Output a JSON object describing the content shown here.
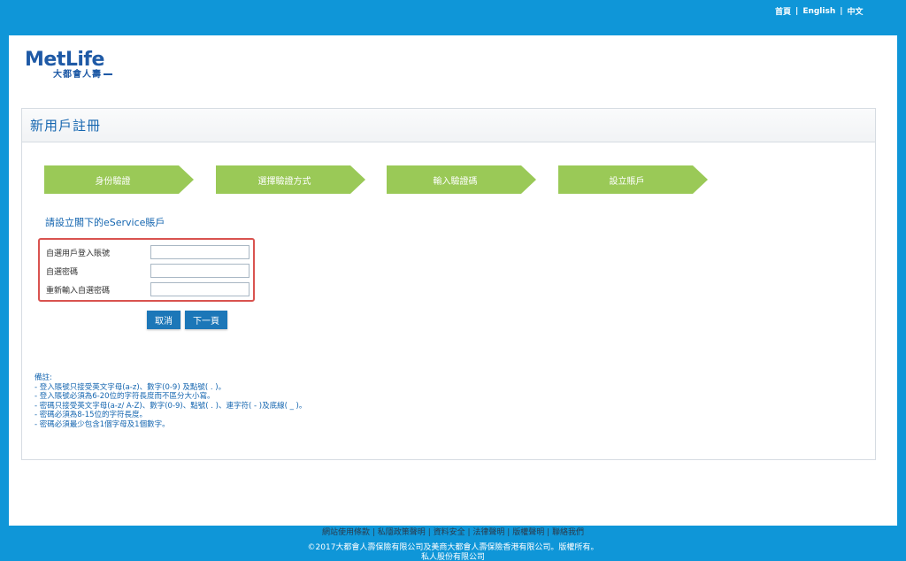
{
  "top_links": [
    "首頁",
    "English",
    "中文"
  ],
  "logo": {
    "main": "MetLife",
    "sub": "大都會人壽"
  },
  "page_title": "新用戶註冊",
  "steps": [
    "身份驗證",
    "選擇驗證方式",
    "輸入驗證碼",
    "設立賬戶"
  ],
  "section_title": "請設立閣下的eService賬戶",
  "form": {
    "fields": [
      {
        "label": "自選用戶登入賬號",
        "value": ""
      },
      {
        "label": "自選密碼",
        "value": ""
      },
      {
        "label": "重新輸入自選密碼",
        "value": ""
      }
    ]
  },
  "buttons": {
    "cancel": "取消",
    "next": "下一頁"
  },
  "notes": {
    "title": "備註:",
    "items": [
      "- 登入賬號只接受英文字母(a-z)、數字(0-9) 及點號( . )。",
      "- 登入賬號必須為6-20位的字符長度而不區分大小寫。",
      "- 密碼只接受英文字母(a-z/ A-Z)、數字(0-9)、點號( . )、連字符( - )及底線( _ )。",
      "- 密碼必須為8-15位的字符長度。",
      "- 密碼必須最少包含1個字母及1個數字。"
    ]
  },
  "footer": {
    "links": [
      "網站使用條款",
      "私隱政策聲明",
      "資料安全",
      "法律聲明",
      "版權聲明",
      "聯絡我們"
    ],
    "copyright_line1": "©2017大都會人壽保險有限公司及美商大都會人壽保險香港有限公司。版權所有。",
    "copyright_line2": "私人股份有限公司"
  },
  "colors": {
    "background": "#0f96d8",
    "step_green": "#9ac957",
    "button_blue": "#1c77b8",
    "highlight_red": "#d9534f",
    "text_blue": "#1566b0"
  }
}
